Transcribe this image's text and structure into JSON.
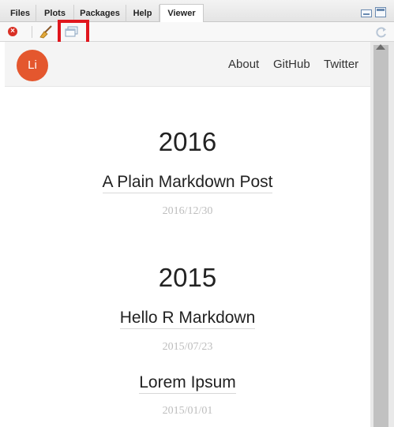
{
  "tabs": [
    {
      "label": "Files"
    },
    {
      "label": "Plots"
    },
    {
      "label": "Packages"
    },
    {
      "label": "Help"
    },
    {
      "label": "Viewer",
      "active": true
    }
  ],
  "toolbar": {
    "icons": [
      "stop-icon",
      "broom-icon",
      "popout-window-icon",
      "refresh-icon"
    ]
  },
  "site": {
    "logo_text": "Li",
    "logo_color": "#e4572e",
    "nav": [
      {
        "label": "About"
      },
      {
        "label": "GitHub"
      },
      {
        "label": "Twitter"
      }
    ]
  },
  "archive": [
    {
      "year": "2016",
      "posts": [
        {
          "title": "A Plain Markdown Post",
          "date": "2016/12/30"
        }
      ]
    },
    {
      "year": "2015",
      "posts": [
        {
          "title": "Hello R Markdown",
          "date": "2015/07/23"
        },
        {
          "title": "Lorem Ipsum",
          "date": "2015/01/01"
        }
      ]
    }
  ],
  "highlight_color": "#e0161d"
}
